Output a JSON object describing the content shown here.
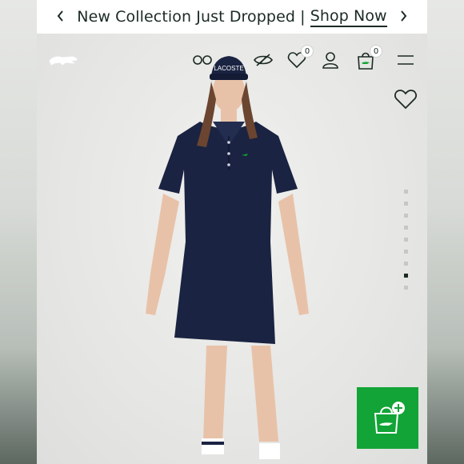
{
  "promo": {
    "text": "New Collection Just Dropped |",
    "link": "Shop Now"
  },
  "header": {
    "wishlist_count": "0",
    "cart_count": "0"
  },
  "carousel": {
    "total_slides": 9,
    "active_slide": 8
  },
  "colors": {
    "accent_green": "#12a436",
    "dress_navy": "#1a2341",
    "text_dark": "#1b2a24"
  },
  "icons": [
    "chevron-left-icon",
    "chevron-right-icon",
    "crocodile-logo-icon",
    "accessibility-icon",
    "hide-icon",
    "heart-icon",
    "user-icon",
    "shopping-bag-icon",
    "menu-icon",
    "plus-icon"
  ]
}
